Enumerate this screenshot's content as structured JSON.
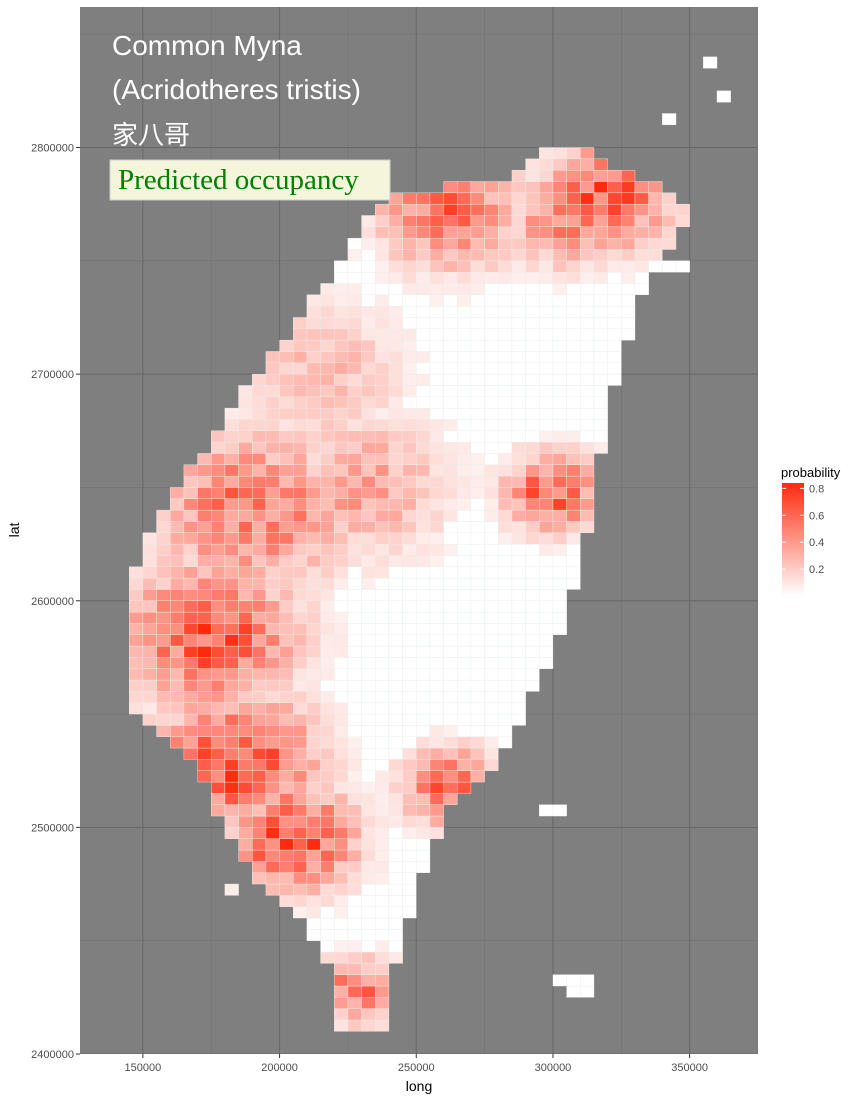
{
  "chart_data": {
    "type": "heatmap",
    "title_lines": [
      "Common Myna",
      "(Acridotheres tristis)",
      "家八哥"
    ],
    "badge": "Predicted occupancy",
    "xlabel": "long",
    "ylabel": "lat",
    "xlim": [
      127000,
      375000
    ],
    "ylim": [
      2400000,
      2862000
    ],
    "x_ticks": [
      150000,
      200000,
      250000,
      300000,
      350000
    ],
    "x_tick_labels": [
      "150000",
      "200000",
      "250000",
      "300000",
      "350000"
    ],
    "y_ticks": [
      2400000,
      2500000,
      2600000,
      2700000,
      2800000
    ],
    "y_tick_labels": [
      "2400000",
      "2500000",
      "2600000",
      "2700000",
      "2800000"
    ],
    "grid": true,
    "panel_background": "#7f7f7f",
    "cell_size_m": 5000,
    "legend": {
      "title": "probability",
      "position": "right",
      "breaks": [
        0.2,
        0.4,
        0.6,
        0.8
      ],
      "break_labels": [
        "0.2",
        "0.4",
        "0.6",
        "0.8"
      ],
      "range": [
        0.0,
        0.84
      ],
      "color_low": "#ffffff",
      "color_high": "#ff2a0e"
    },
    "regions": [
      {
        "name": "taiwan-main",
        "outline": [
          [
            224000,
            2408000
          ],
          [
            238000,
            2410000
          ],
          [
            240000,
            2425000
          ],
          [
            244000,
            2445000
          ],
          [
            252000,
            2478000
          ],
          [
            262000,
            2508000
          ],
          [
            278000,
            2528000
          ],
          [
            288000,
            2548000
          ],
          [
            298000,
            2572000
          ],
          [
            306000,
            2598000
          ],
          [
            312000,
            2625000
          ],
          [
            315000,
            2650000
          ],
          [
            322000,
            2690000
          ],
          [
            327000,
            2715000
          ],
          [
            333000,
            2735000
          ],
          [
            338000,
            2748000
          ],
          [
            345000,
            2760000
          ],
          [
            352000,
            2768000
          ],
          [
            344000,
            2778000
          ],
          [
            330000,
            2788000
          ],
          [
            318000,
            2795000
          ],
          [
            308000,
            2800000
          ],
          [
            298000,
            2802000
          ],
          [
            292000,
            2792000
          ],
          [
            285000,
            2785000
          ],
          [
            272000,
            2784000
          ],
          [
            258000,
            2782000
          ],
          [
            246000,
            2780000
          ],
          [
            232000,
            2770000
          ],
          [
            226000,
            2755000
          ],
          [
            216000,
            2738000
          ],
          [
            198000,
            2710000
          ],
          [
            185000,
            2690000
          ],
          [
            174000,
            2670000
          ],
          [
            166000,
            2655000
          ],
          [
            156000,
            2636000
          ],
          [
            148000,
            2617000
          ],
          [
            143000,
            2600000
          ],
          [
            143000,
            2582000
          ],
          [
            145000,
            2567000
          ],
          [
            145000,
            2552000
          ],
          [
            156000,
            2542000
          ],
          [
            166000,
            2532000
          ],
          [
            174000,
            2518000
          ],
          [
            180000,
            2500000
          ],
          [
            192000,
            2478000
          ],
          [
            205000,
            2462000
          ],
          [
            214000,
            2448000
          ],
          [
            220000,
            2435000
          ],
          [
            219000,
            2420000
          ]
        ]
      },
      {
        "name": "penghu-islet",
        "outline": [
          [
            179000,
            2470000
          ],
          [
            186000,
            2469000
          ],
          [
            187000,
            2474000
          ],
          [
            180000,
            2475000
          ]
        ]
      },
      {
        "name": "green-island",
        "outline": [
          [
            297000,
            2505000
          ],
          [
            304000,
            2504000
          ],
          [
            305000,
            2511000
          ],
          [
            298000,
            2512000
          ]
        ]
      },
      {
        "name": "orchid-island",
        "outline": [
          [
            298000,
            2438000
          ],
          [
            306000,
            2436000
          ],
          [
            312000,
            2438000
          ],
          [
            314000,
            2430000
          ],
          [
            312000,
            2425000
          ],
          [
            306000,
            2428000
          ],
          [
            300000,
            2432000
          ]
        ]
      },
      {
        "name": "keelung-islet",
        "outline": [
          [
            341000,
            2745000
          ],
          [
            348000,
            2745000
          ],
          [
            348000,
            2751000
          ],
          [
            341000,
            2751000
          ]
        ]
      },
      {
        "name": "matsu-islet-a",
        "outline": [
          [
            355000,
            2833000
          ],
          [
            360000,
            2833000
          ],
          [
            360000,
            2838000
          ],
          [
            355000,
            2838000
          ]
        ]
      },
      {
        "name": "matsu-islet-b",
        "outline": [
          [
            358000,
            2818000
          ],
          [
            363000,
            2818000
          ],
          [
            363000,
            2823000
          ],
          [
            358000,
            2823000
          ]
        ]
      },
      {
        "name": "matsu-islet-c",
        "outline": [
          [
            342000,
            2812000
          ],
          [
            347000,
            2812000
          ],
          [
            347000,
            2816000
          ],
          [
            342000,
            2816000
          ]
        ]
      }
    ],
    "hotspots": [
      {
        "name": "north-coast",
        "long": 262000,
        "lat": 2772000,
        "probability": 0.62,
        "spread_m": 18000
      },
      {
        "name": "northeast-cape",
        "long": 320000,
        "lat": 2778000,
        "probability": 0.74,
        "spread_m": 16000
      },
      {
        "name": "taipei-basin",
        "long": 305000,
        "lat": 2768000,
        "probability": 0.58,
        "spread_m": 14000
      },
      {
        "name": "east-coast-mid",
        "long": 300000,
        "lat": 2648000,
        "probability": 0.72,
        "spread_m": 12000
      },
      {
        "name": "west-plain-north",
        "long": 190000,
        "lat": 2640000,
        "probability": 0.6,
        "spread_m": 24000
      },
      {
        "name": "west-plain-central",
        "long": 175000,
        "lat": 2585000,
        "probability": 0.74,
        "spread_m": 22000
      },
      {
        "name": "west-plain-south",
        "long": 185000,
        "lat": 2530000,
        "probability": 0.8,
        "spread_m": 20000
      },
      {
        "name": "southwest-coast",
        "long": 205000,
        "lat": 2495000,
        "probability": 0.82,
        "spread_m": 16000
      },
      {
        "name": "east-rift-south",
        "long": 262000,
        "lat": 2518000,
        "probability": 0.68,
        "spread_m": 12000
      },
      {
        "name": "southern-tip",
        "long": 228000,
        "lat": 2428000,
        "probability": 0.6,
        "spread_m": 10000
      },
      {
        "name": "central-hills",
        "long": 230000,
        "lat": 2650000,
        "probability": 0.4,
        "spread_m": 22000
      },
      {
        "name": "northwest-hills",
        "long": 215000,
        "lat": 2700000,
        "probability": 0.3,
        "spread_m": 22000
      }
    ]
  }
}
